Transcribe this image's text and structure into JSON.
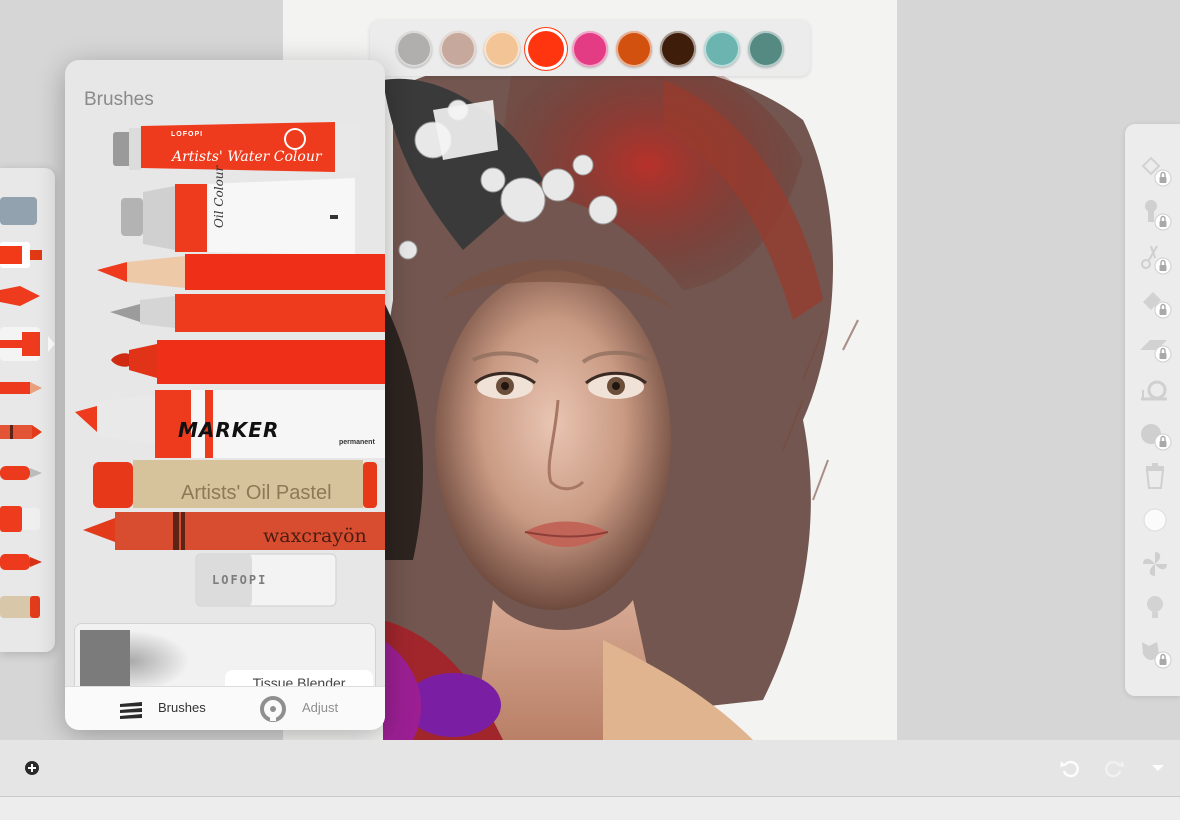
{
  "palette": {
    "colors": [
      "#b1aeae",
      "#c7a89c",
      "#f2c496",
      "#ff3510",
      "#e43b85",
      "#d2510f",
      "#3f1d0b",
      "#6bb4b0",
      "#558a83"
    ],
    "selected_index": 3
  },
  "brushes_panel": {
    "title": "Brushes",
    "tools": {
      "watercolour_brand": "LOFOPI",
      "watercolour_label": "Artists' Water Colour",
      "oil_label": "Oil Colour",
      "marker_label": "MARKER",
      "marker_sub": "permanent",
      "pastel_label": "Artists' Oil Pastel",
      "crayon_label": "waxcrayön",
      "eraser_label": "LOFOPI"
    },
    "current_brush": "Tissue Blender",
    "tabs": [
      {
        "label": "Brushes",
        "icon": "brushes-stack-icon",
        "active": true
      },
      {
        "label": "Adjust",
        "icon": "adjust-dial-icon",
        "active": false
      }
    ]
  },
  "brush_rail": {
    "icons": [
      "color-swatch-icon",
      "watercolour-tube-icon",
      "oil-tube-icon",
      "marker-icon",
      "pencil-icon",
      "crayon-icon",
      "pen-icon",
      "marker-thick-icon",
      "felt-tip-icon",
      "pastel-icon"
    ]
  },
  "right_toolbar": {
    "tools": [
      "transform-locked-icon",
      "brush-stamp-locked-icon",
      "scissors-locked-icon",
      "fill-bucket-locked-icon",
      "ruler-locked-icon",
      "snail-icon",
      "reference-locked-icon",
      "trash-icon",
      "blank-circle-icon",
      "pinwheel-icon",
      "lightbulb-icon",
      "mask-locked-icon"
    ]
  },
  "bottom_bar": {
    "icons": [
      "add-icon",
      "undo-icon",
      "redo-icon",
      "chevron-down-icon"
    ]
  }
}
